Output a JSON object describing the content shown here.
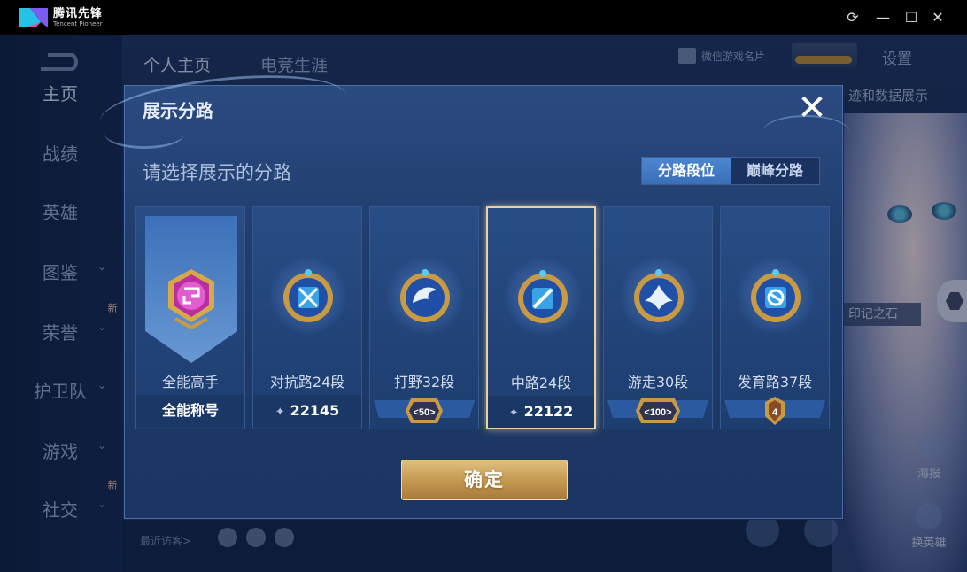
{
  "app": {
    "brand_name": "腾讯先锋",
    "brand_sub": "Tencent Pioneer",
    "window_controls": {
      "refresh": "⟳",
      "minimize": "—",
      "maximize": "☐",
      "close": "✕"
    }
  },
  "game": {
    "top_nav": [
      "个人主页",
      "电竞生涯"
    ],
    "sidebar": [
      {
        "label": "主页",
        "arrow": "",
        "new": ""
      },
      {
        "label": "战绩",
        "arrow": "",
        "new": ""
      },
      {
        "label": "英雄",
        "arrow": "",
        "new": ""
      },
      {
        "label": "图鉴",
        "arrow": "⌄",
        "new": ""
      },
      {
        "label": "荣誉",
        "arrow": "⌄",
        "new": "新"
      },
      {
        "label": "护卫队",
        "arrow": "⌄",
        "new": ""
      },
      {
        "label": "游戏",
        "arrow": "⌄",
        "new": ""
      },
      {
        "label": "社交",
        "arrow": "⌄",
        "new": "新"
      }
    ],
    "wechat_card": "微信游戏名片",
    "settings": "设置",
    "right_tag": "迹和数据展示",
    "stone_tag": "印记之石",
    "side_buttons": [
      {
        "label": "海报"
      },
      {
        "label": "换英雄"
      }
    ],
    "recent_visitors": "最近访客>"
  },
  "dialog": {
    "title": "展示分路",
    "close_symbol": "✕",
    "subtitle": "请选择展示的分路",
    "tabs": [
      {
        "label": "分路段位",
        "active": true
      },
      {
        "label": "巅峰分路",
        "active": false
      }
    ],
    "cards": [
      {
        "label": "全能高手",
        "value": "全能称号",
        "value_type": "title",
        "emblem": "allround-emblem-icon",
        "selected": false
      },
      {
        "label": "对抗路24段",
        "value": "22145",
        "value_type": "score",
        "emblem": "clash-lane-emblem-icon",
        "selected": false
      },
      {
        "label": "打野32段",
        "value": "50",
        "value_type": "medal",
        "emblem": "jungle-emblem-icon",
        "selected": false
      },
      {
        "label": "中路24段",
        "value": "22122",
        "value_type": "score",
        "emblem": "mid-lane-emblem-icon",
        "selected": true
      },
      {
        "label": "游走30段",
        "value": "100",
        "value_type": "medal",
        "emblem": "roam-emblem-icon",
        "selected": false
      },
      {
        "label": "发育路37段",
        "value": "4",
        "value_type": "medal-shield",
        "emblem": "farm-lane-emblem-icon",
        "selected": false
      }
    ],
    "confirm_label": "确定"
  },
  "colors": {
    "accent_gold": "#c59a52",
    "selected_border": "#e8d2a4",
    "tab_active": "#4d86d1",
    "emblem_magenta": "#c83ab0",
    "emblem_blue": "#3aa3e6"
  }
}
